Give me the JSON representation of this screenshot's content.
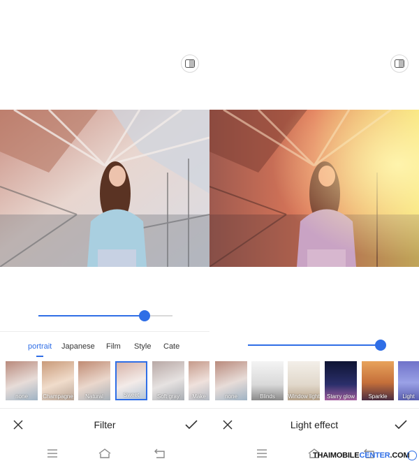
{
  "left_panel": {
    "compare_icon": "compare-split-icon",
    "slider": {
      "value": 0.79
    },
    "tabs": [
      {
        "label": "portrait",
        "active": true
      },
      {
        "label": "Japanese",
        "active": false
      },
      {
        "label": "Film",
        "active": false
      },
      {
        "label": "Style",
        "active": false
      },
      {
        "label": "Cate",
        "active": false
      }
    ],
    "filters": [
      {
        "label": "none",
        "selected": false
      },
      {
        "label": "Champagne",
        "selected": false
      },
      {
        "label": "Natural",
        "selected": false
      },
      {
        "label": "Sweet",
        "selected": true
      },
      {
        "label": "Soft gray",
        "selected": false
      },
      {
        "label": "Make",
        "selected": false
      }
    ],
    "title": "Filter",
    "close_icon": "close-icon",
    "confirm_icon": "checkmark-icon"
  },
  "right_panel": {
    "compare_icon": "compare-split-icon",
    "slider": {
      "value": 0.99
    },
    "effects": [
      {
        "label": "none"
      },
      {
        "label": "Blinds"
      },
      {
        "label": "Window light"
      },
      {
        "label": "Starry glow"
      },
      {
        "label": "Sparkle"
      },
      {
        "label": "Light"
      }
    ],
    "title": "Light effect",
    "close_icon": "close-icon",
    "confirm_icon": "checkmark-icon"
  },
  "navbar": {
    "menu_icon": "menu-icon",
    "home_icon": "home-icon",
    "back_icon": "back-icon"
  },
  "watermark": {
    "brand_main": "THAIMOBILE",
    "brand_accent": "CENTER",
    "brand_suffix": ".COM"
  },
  "colors": {
    "accent": "#2f6ee6",
    "text": "#222222",
    "track": "#d9d9d9"
  }
}
